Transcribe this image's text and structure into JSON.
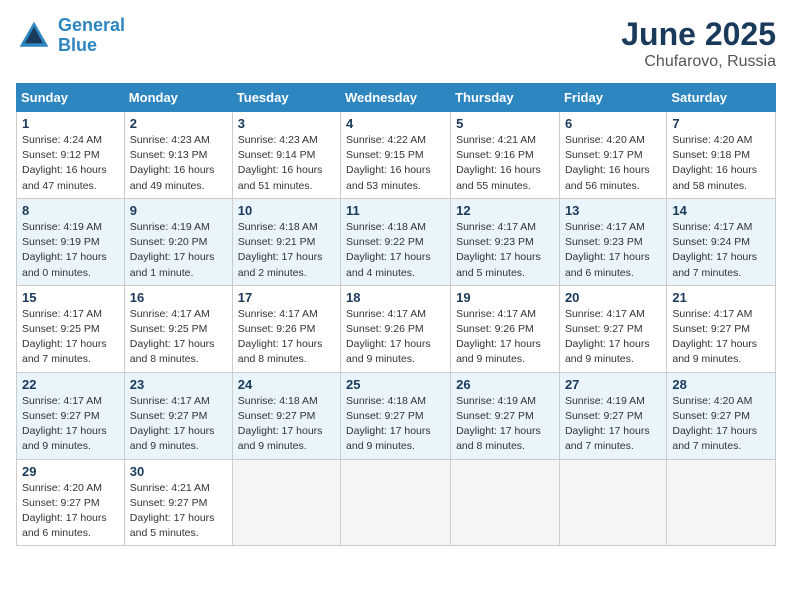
{
  "header": {
    "logo_line1": "General",
    "logo_line2": "Blue",
    "month": "June 2025",
    "location": "Chufarovo, Russia"
  },
  "weekdays": [
    "Sunday",
    "Monday",
    "Tuesday",
    "Wednesday",
    "Thursday",
    "Friday",
    "Saturday"
  ],
  "weeks": [
    [
      {
        "day": "1",
        "info": "Sunrise: 4:24 AM\nSunset: 9:12 PM\nDaylight: 16 hours and 47 minutes."
      },
      {
        "day": "2",
        "info": "Sunrise: 4:23 AM\nSunset: 9:13 PM\nDaylight: 16 hours and 49 minutes."
      },
      {
        "day": "3",
        "info": "Sunrise: 4:23 AM\nSunset: 9:14 PM\nDaylight: 16 hours and 51 minutes."
      },
      {
        "day": "4",
        "info": "Sunrise: 4:22 AM\nSunset: 9:15 PM\nDaylight: 16 hours and 53 minutes."
      },
      {
        "day": "5",
        "info": "Sunrise: 4:21 AM\nSunset: 9:16 PM\nDaylight: 16 hours and 55 minutes."
      },
      {
        "day": "6",
        "info": "Sunrise: 4:20 AM\nSunset: 9:17 PM\nDaylight: 16 hours and 56 minutes."
      },
      {
        "day": "7",
        "info": "Sunrise: 4:20 AM\nSunset: 9:18 PM\nDaylight: 16 hours and 58 minutes."
      }
    ],
    [
      {
        "day": "8",
        "info": "Sunrise: 4:19 AM\nSunset: 9:19 PM\nDaylight: 17 hours and 0 minutes."
      },
      {
        "day": "9",
        "info": "Sunrise: 4:19 AM\nSunset: 9:20 PM\nDaylight: 17 hours and 1 minute."
      },
      {
        "day": "10",
        "info": "Sunrise: 4:18 AM\nSunset: 9:21 PM\nDaylight: 17 hours and 2 minutes."
      },
      {
        "day": "11",
        "info": "Sunrise: 4:18 AM\nSunset: 9:22 PM\nDaylight: 17 hours and 4 minutes."
      },
      {
        "day": "12",
        "info": "Sunrise: 4:17 AM\nSunset: 9:23 PM\nDaylight: 17 hours and 5 minutes."
      },
      {
        "day": "13",
        "info": "Sunrise: 4:17 AM\nSunset: 9:23 PM\nDaylight: 17 hours and 6 minutes."
      },
      {
        "day": "14",
        "info": "Sunrise: 4:17 AM\nSunset: 9:24 PM\nDaylight: 17 hours and 7 minutes."
      }
    ],
    [
      {
        "day": "15",
        "info": "Sunrise: 4:17 AM\nSunset: 9:25 PM\nDaylight: 17 hours and 7 minutes."
      },
      {
        "day": "16",
        "info": "Sunrise: 4:17 AM\nSunset: 9:25 PM\nDaylight: 17 hours and 8 minutes."
      },
      {
        "day": "17",
        "info": "Sunrise: 4:17 AM\nSunset: 9:26 PM\nDaylight: 17 hours and 8 minutes."
      },
      {
        "day": "18",
        "info": "Sunrise: 4:17 AM\nSunset: 9:26 PM\nDaylight: 17 hours and 9 minutes."
      },
      {
        "day": "19",
        "info": "Sunrise: 4:17 AM\nSunset: 9:26 PM\nDaylight: 17 hours and 9 minutes."
      },
      {
        "day": "20",
        "info": "Sunrise: 4:17 AM\nSunset: 9:27 PM\nDaylight: 17 hours and 9 minutes."
      },
      {
        "day": "21",
        "info": "Sunrise: 4:17 AM\nSunset: 9:27 PM\nDaylight: 17 hours and 9 minutes."
      }
    ],
    [
      {
        "day": "22",
        "info": "Sunrise: 4:17 AM\nSunset: 9:27 PM\nDaylight: 17 hours and 9 minutes."
      },
      {
        "day": "23",
        "info": "Sunrise: 4:17 AM\nSunset: 9:27 PM\nDaylight: 17 hours and 9 minutes."
      },
      {
        "day": "24",
        "info": "Sunrise: 4:18 AM\nSunset: 9:27 PM\nDaylight: 17 hours and 9 minutes."
      },
      {
        "day": "25",
        "info": "Sunrise: 4:18 AM\nSunset: 9:27 PM\nDaylight: 17 hours and 9 minutes."
      },
      {
        "day": "26",
        "info": "Sunrise: 4:19 AM\nSunset: 9:27 PM\nDaylight: 17 hours and 8 minutes."
      },
      {
        "day": "27",
        "info": "Sunrise: 4:19 AM\nSunset: 9:27 PM\nDaylight: 17 hours and 7 minutes."
      },
      {
        "day": "28",
        "info": "Sunrise: 4:20 AM\nSunset: 9:27 PM\nDaylight: 17 hours and 7 minutes."
      }
    ],
    [
      {
        "day": "29",
        "info": "Sunrise: 4:20 AM\nSunset: 9:27 PM\nDaylight: 17 hours and 6 minutes."
      },
      {
        "day": "30",
        "info": "Sunrise: 4:21 AM\nSunset: 9:27 PM\nDaylight: 17 hours and 5 minutes."
      },
      null,
      null,
      null,
      null,
      null
    ]
  ]
}
